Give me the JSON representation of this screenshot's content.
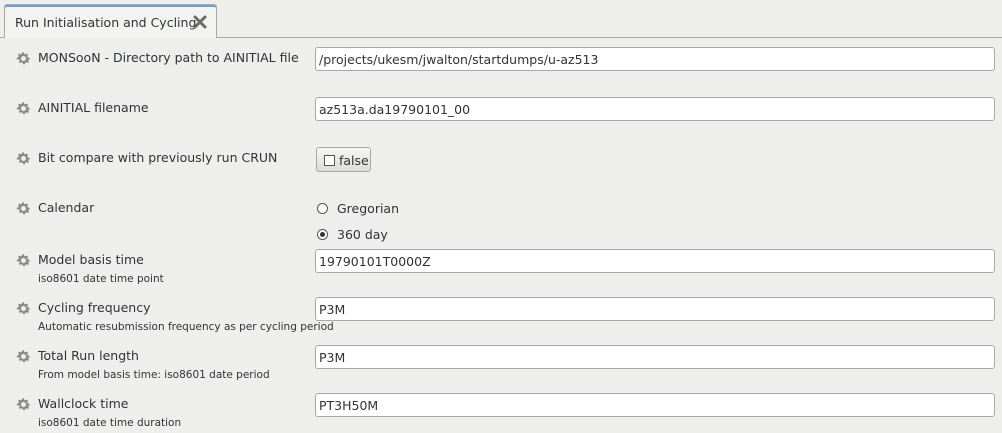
{
  "tab": {
    "title": "Run Initialisation and Cycling",
    "close_icon": "close-icon"
  },
  "fields": {
    "ainitial_dir": {
      "label": "MONSooN - Directory path to AINITIAL file",
      "value": "/projects/ukesm/jwalton/startdumps/u-az513"
    },
    "ainitial_file": {
      "label": "AINITIAL filename",
      "value": "az513a.da19790101_00"
    },
    "bit_compare": {
      "label": "Bit compare with previously run CRUN",
      "value": "false"
    },
    "calendar": {
      "label": "Calendar",
      "options": [
        "Gregorian",
        "360 day"
      ],
      "selected": "360 day"
    },
    "basis_time": {
      "label": "Model basis time",
      "description": "iso8601 date time point",
      "value": "19790101T0000Z"
    },
    "cycling_freq": {
      "label": "Cycling frequency",
      "description": "Automatic resubmission frequency as per cycling period",
      "value": "P3M"
    },
    "run_length": {
      "label": "Total Run length",
      "description": "From model basis time: iso8601 date period",
      "value": "P3M"
    },
    "wallclock": {
      "label": "Wallclock time",
      "description": "iso8601 date time duration",
      "value": "PT3H50M"
    }
  }
}
